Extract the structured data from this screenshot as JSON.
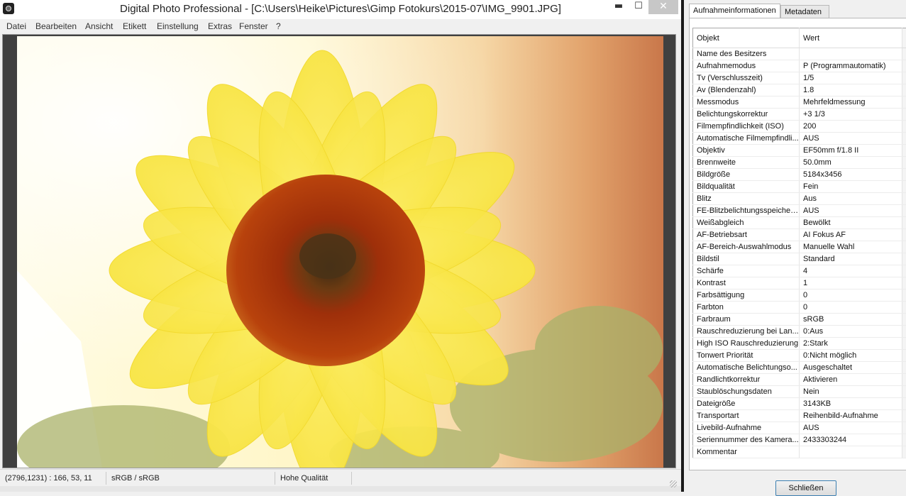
{
  "window": {
    "title": "Digital Photo Professional - [C:\\Users\\Heike\\Pictures\\Gimp Fotokurs\\2015-07\\IMG_9901.JPG]",
    "minimize": "▬",
    "maximize": "☐",
    "close": "✕"
  },
  "menu": [
    "Datei",
    "Bearbeiten",
    "Ansicht",
    "Etikett",
    "Einstellung",
    "Extras",
    "Fenster",
    "?"
  ],
  "status": {
    "pixel_info": "(2796,1231) : 166, 53, 11",
    "color_space": "sRGB / sRGB",
    "quality": "Hohe Qualität"
  },
  "panel": {
    "tabs": [
      "Aufnahmeinformationen",
      "Metadaten"
    ],
    "table_header": [
      "Objekt",
      "Wert"
    ],
    "rows": [
      [
        "Name des Besitzers",
        ""
      ],
      [
        "Aufnahmemodus",
        "P (Programmautomatik)"
      ],
      [
        "Tv (Verschlusszeit)",
        "1/5"
      ],
      [
        "Av (Blendenzahl)",
        "1.8"
      ],
      [
        "Messmodus",
        "Mehrfeldmessung"
      ],
      [
        "Belichtungskorrektur",
        "+3 1/3"
      ],
      [
        "Filmempfindlichkeit (ISO)",
        "200"
      ],
      [
        "Automatische Filmempfindli...",
        "AUS"
      ],
      [
        "Objektiv",
        "EF50mm f/1.8 II"
      ],
      [
        "Brennweite",
        "50.0mm"
      ],
      [
        "Bildgröße",
        "5184x3456"
      ],
      [
        "Bildqualität",
        "Fein"
      ],
      [
        "Blitz",
        "Aus"
      ],
      [
        "FE-Blitzbelichtungsspeicher...",
        "AUS"
      ],
      [
        "Weißabgleich",
        "Bewölkt"
      ],
      [
        "AF-Betriebsart",
        "AI Fokus AF"
      ],
      [
        "AF-Bereich-Auswahlmodus",
        "Manuelle  Wahl"
      ],
      [
        "Bildstil",
        "Standard"
      ],
      [
        "Schärfe",
        "4"
      ],
      [
        "Kontrast",
        "1"
      ],
      [
        "Farbsättigung",
        "0"
      ],
      [
        "Farbton",
        "0"
      ],
      [
        "Farbraum",
        "sRGB"
      ],
      [
        "Rauschreduzierung bei Lan...",
        "0:Aus"
      ],
      [
        "High ISO Rauschreduzierung",
        "2:Stark"
      ],
      [
        "Tonwert Priorität",
        "0:Nicht möglich"
      ],
      [
        "Automatische Belichtungso...",
        "Ausgeschaltet"
      ],
      [
        "Randlichtkorrektur",
        "Aktivieren"
      ],
      [
        "Staublöschungsdaten",
        "Nein"
      ],
      [
        "Dateigröße",
        "3143KB"
      ],
      [
        "Transportart",
        "Reihenbild-Aufnahme"
      ],
      [
        "Livebild-Aufnahme",
        "AUS"
      ],
      [
        "Seriennummer des Kamera...",
        "2433303244"
      ],
      [
        "Kommentar",
        ""
      ]
    ],
    "close_button": "Schließen"
  },
  "colors": {
    "viewer_background": "#404040",
    "close_button_border": "#3c7fb1"
  },
  "photo_subject": "sunflower-photo"
}
